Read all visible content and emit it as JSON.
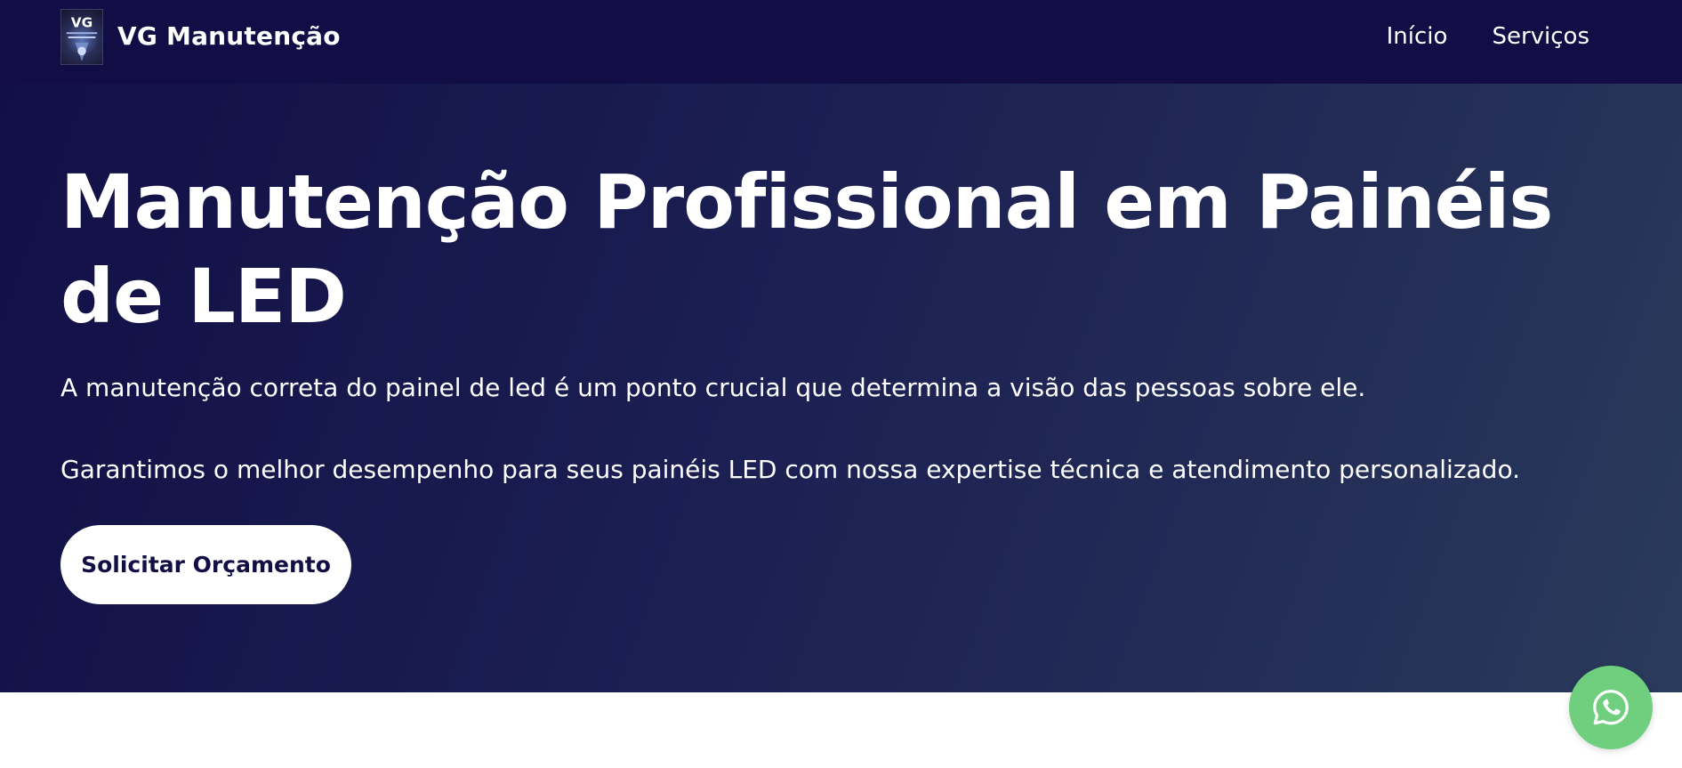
{
  "header": {
    "brand_name": "VG Manutenção",
    "logo_icon": "vg-logo-icon",
    "nav": [
      {
        "label": "Início"
      },
      {
        "label": "Serviços"
      }
    ]
  },
  "hero": {
    "title": "Manutenção Profissional em Painéis de LED",
    "paragraph_1": "A manutenção correta do painel de led é um ponto crucial que determina a visão das pessoas sobre ele.",
    "paragraph_2": "Garantimos o melhor desempenho para seus painéis LED com nossa expertise técnica e atendimento personalizado.",
    "cta_label": "Solicitar Orçamento"
  },
  "floating": {
    "whatsapp_icon": "whatsapp-icon"
  },
  "colors": {
    "navbar_bg": "#120e45",
    "hero_gradient_start": "#120f46",
    "hero_gradient_end": "#2a3b5c",
    "cta_text": "#130f45",
    "whatsapp_green": "#6fcf7e"
  }
}
